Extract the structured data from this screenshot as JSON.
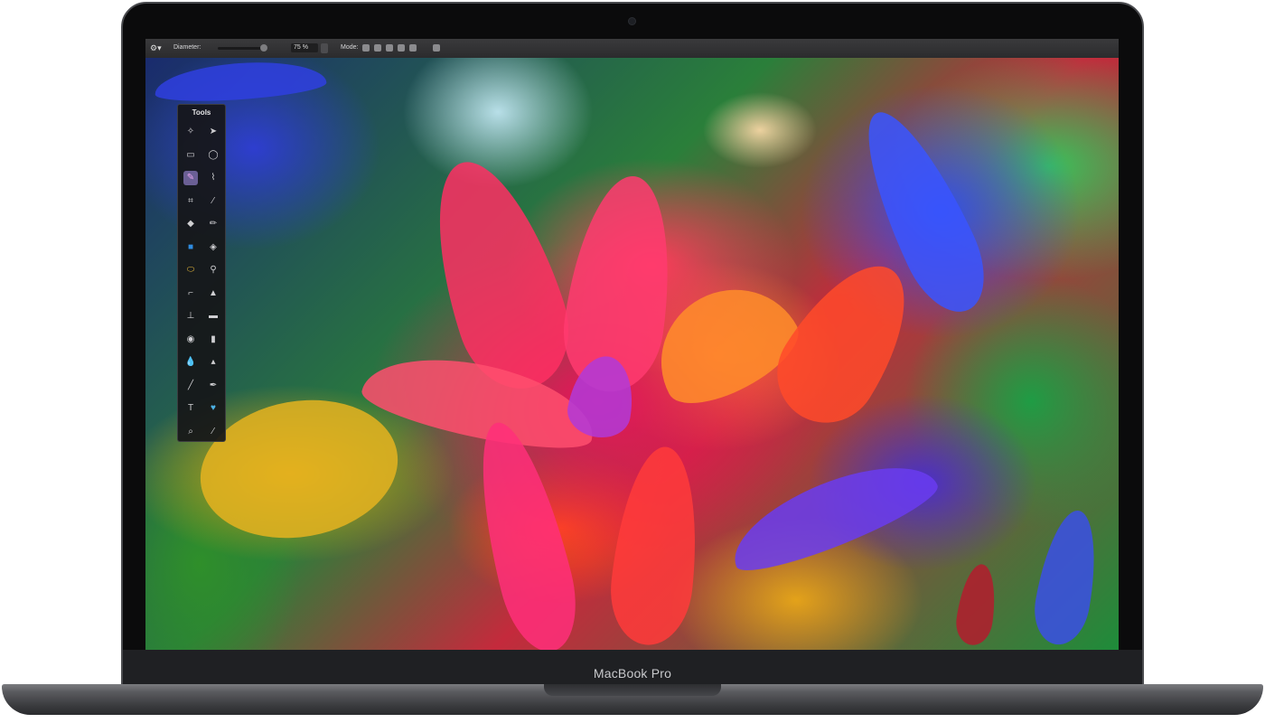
{
  "device": {
    "brand_label": "MacBook Pro"
  },
  "toolbar": {
    "diameter_label": "Diameter:",
    "zoom_value": "75 %",
    "mode_label": "Mode:",
    "mode_buttons": [
      "normal",
      "add",
      "subtract",
      "intersect",
      "exclude",
      "custom"
    ]
  },
  "tools_palette": {
    "title": "Tools",
    "tools": [
      {
        "name": "magic-wand-tool",
        "icon": "✧"
      },
      {
        "name": "arrow-tool",
        "icon": "➤"
      },
      {
        "name": "rect-select-tool",
        "icon": "▭"
      },
      {
        "name": "ellipse-select-tool",
        "icon": "◯"
      },
      {
        "name": "brush-tool",
        "icon": "✎"
      },
      {
        "name": "lasso-tool",
        "icon": "⌇"
      },
      {
        "name": "crop-tool",
        "icon": "⌗"
      },
      {
        "name": "eyedropper-tool",
        "icon": "⁄"
      },
      {
        "name": "eraser-tool",
        "icon": "◆"
      },
      {
        "name": "pencil-tool",
        "icon": "✏"
      },
      {
        "name": "fill-tool",
        "icon": "■"
      },
      {
        "name": "paint-bucket-tool",
        "icon": "◈"
      },
      {
        "name": "sponge-tool",
        "icon": "⬭"
      },
      {
        "name": "smudge-tool",
        "icon": "⚲"
      },
      {
        "name": "paintbrush-tool",
        "icon": "⌐"
      },
      {
        "name": "burn-tool",
        "icon": "▲"
      },
      {
        "name": "stamp-tool",
        "icon": "⊥"
      },
      {
        "name": "bandage-tool",
        "icon": "▬"
      },
      {
        "name": "red-eye-tool",
        "icon": "◉"
      },
      {
        "name": "marker-tool",
        "icon": "▮"
      },
      {
        "name": "blur-tool",
        "icon": "💧"
      },
      {
        "name": "sharpen-tool",
        "icon": "▴"
      },
      {
        "name": "line-tool",
        "icon": "╱"
      },
      {
        "name": "pen-tool",
        "icon": "✒"
      },
      {
        "name": "text-tool",
        "icon": "T"
      },
      {
        "name": "shape-tool",
        "icon": "♥"
      },
      {
        "name": "zoom-tool",
        "icon": "⌕"
      },
      {
        "name": "hand-tool",
        "icon": "⁄"
      }
    ]
  },
  "colors": {
    "lid": "#0b0b0c",
    "palette_bg": "#161618",
    "active_tool": "#6a5f95",
    "shape_icon": "#4db3e6",
    "fill_icon": "#2f8ce0",
    "sponge_icon": "#e0b43a"
  }
}
